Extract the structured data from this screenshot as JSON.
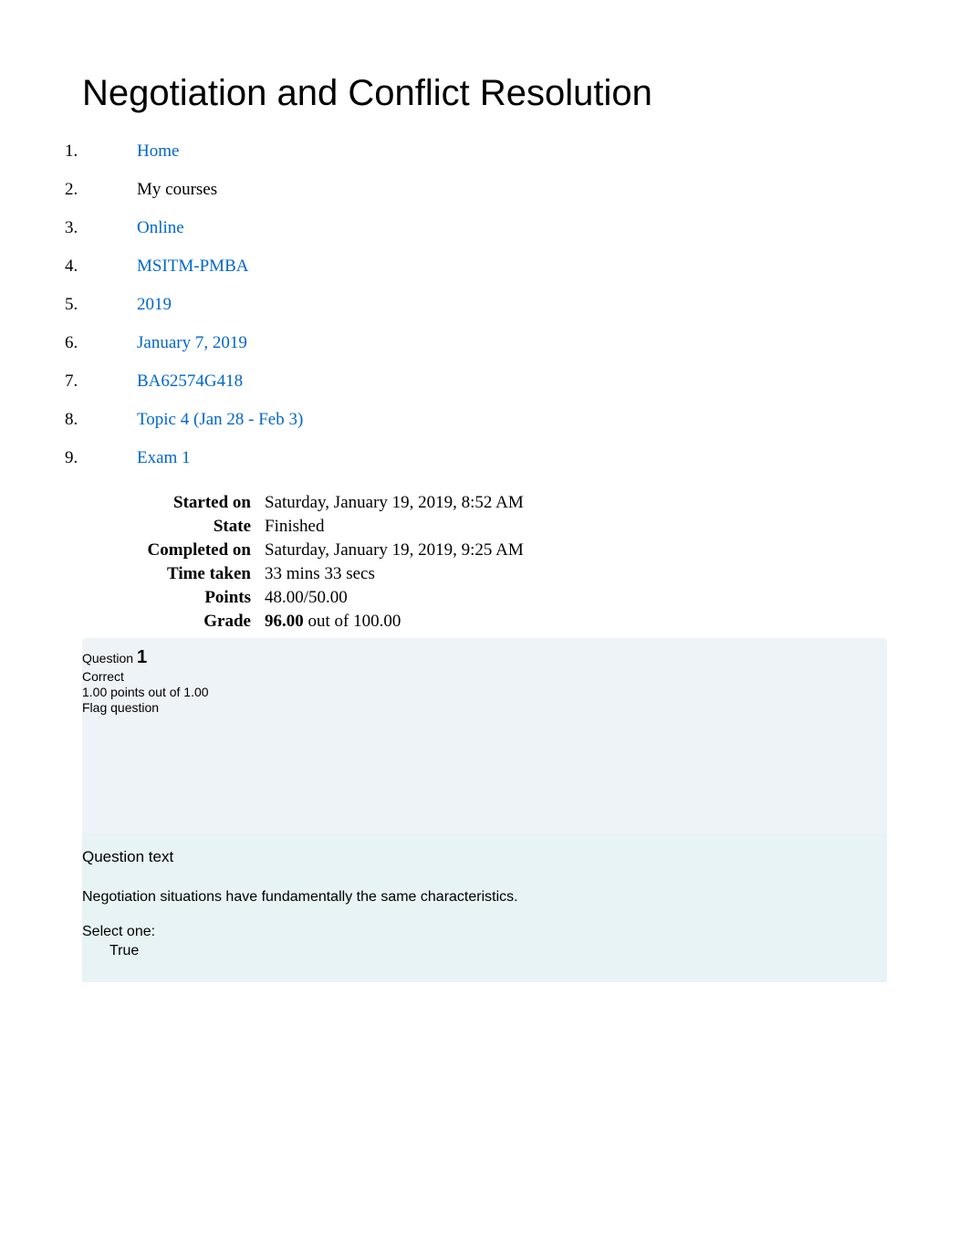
{
  "page_title": "Negotiation and Conflict Resolution",
  "breadcrumb": {
    "items": [
      {
        "text": "Home",
        "link": true
      },
      {
        "text": "My courses",
        "link": false
      },
      {
        "text": "Online",
        "link": true
      },
      {
        "text": "MSITM-PMBA",
        "link": true
      },
      {
        "text": "2019",
        "link": true
      },
      {
        "text": "January 7, 2019",
        "link": true
      },
      {
        "text": "BA62574G418",
        "link": true
      },
      {
        "text": "Topic 4 (Jan 28 - Feb 3)",
        "link": true
      },
      {
        "text": "Exam 1",
        "link": true
      }
    ]
  },
  "summary": {
    "started_on_label": "Started on",
    "started_on_value": "Saturday, January 19, 2019, 8:52 AM",
    "state_label": "State",
    "state_value": "Finished",
    "completed_on_label": "Completed on",
    "completed_on_value": "Saturday, January 19, 2019, 9:25 AM",
    "time_taken_label": "Time taken",
    "time_taken_value": "33 mins 33 secs",
    "points_label": "Points",
    "points_value": "48.00/50.00",
    "grade_label": "Grade",
    "grade_value_bold": "96.00",
    "grade_value_rest": " out of 100.00"
  },
  "question": {
    "label_prefix": "Question ",
    "number": "1",
    "status": "Correct",
    "points": "1.00 points out of 1.00",
    "flag": "Flag question",
    "text_heading": "Question text",
    "prompt": "Negotiation situations have fundamentally the same characteristics.",
    "select_label": "Select one:",
    "option_true": "True"
  }
}
